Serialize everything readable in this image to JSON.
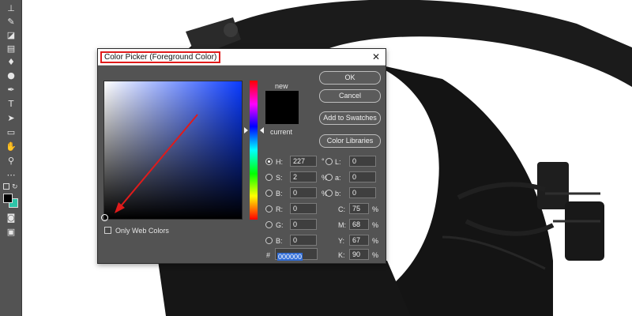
{
  "dialog": {
    "title": "Color Picker (Foreground Color)",
    "close_glyph": "✕",
    "new_label": "new",
    "current_label": "current",
    "only_web_colors_label": "Only Web Colors",
    "buttons": {
      "ok": "OK",
      "cancel": "Cancel",
      "add_to_swatches": "Add to Swatches",
      "color_libraries": "Color Libraries"
    },
    "fields": {
      "H": {
        "label": "H:",
        "value": "227",
        "unit": "°",
        "selected": true
      },
      "S": {
        "label": "S:",
        "value": "2",
        "unit": "%"
      },
      "B": {
        "label": "B:",
        "value": "0",
        "unit": "%"
      },
      "R": {
        "label": "R:",
        "value": "0"
      },
      "G": {
        "label": "G:",
        "value": "0"
      },
      "Bl": {
        "label": "B:",
        "value": "0"
      },
      "L": {
        "label": "L:",
        "value": "0"
      },
      "a": {
        "label": "a:",
        "value": "0"
      },
      "b": {
        "label": "b:",
        "value": "0"
      },
      "C": {
        "label": "C:",
        "value": "75",
        "unit": "%"
      },
      "M": {
        "label": "M:",
        "value": "68",
        "unit": "%"
      },
      "Y": {
        "label": "Y:",
        "value": "67",
        "unit": "%"
      },
      "K": {
        "label": "K:",
        "value": "90",
        "unit": "%"
      }
    },
    "hex": {
      "label": "#",
      "value": "000000"
    },
    "colors": {
      "new": "#000000",
      "current": "#000000",
      "field_hue": "#0a3bff"
    }
  },
  "toolbar": {
    "icons": [
      "stamp-icon",
      "history-brush-icon",
      "eraser-icon",
      "gradient-icon",
      "blur-icon",
      "dodge-icon",
      "pen-icon",
      "type-icon",
      "path-selection-icon",
      "rectangle-icon",
      "hand-icon",
      "zoom-icon",
      "more-tools-icon"
    ],
    "foreground_color": "#000000",
    "background_color": "#2ec4a8"
  },
  "colors": {
    "annotation": "#e01b1b",
    "dialog_bg": "#535353"
  }
}
